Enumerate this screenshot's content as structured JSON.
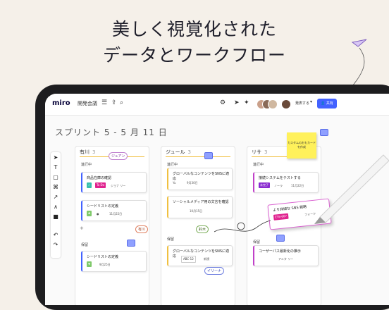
{
  "headline": {
    "line1": "美しく視覚化された",
    "line2": "データとワークフロー"
  },
  "topbar": {
    "logo": "miro",
    "board_name": "開発会議",
    "present_label": "発表する",
    "share_label": "共有"
  },
  "board": {
    "title": "スプリント 5 - 5 月 11 日"
  },
  "columns": [
    {
      "name": "有川",
      "count": "3",
      "sections": [
        {
          "label": "進行中"
        },
        {
          "label": "保留"
        }
      ],
      "cards": [
        {
          "title": "商品在庫の確認",
          "tag": "To Do",
          "assignee": "ジョナ リー"
        },
        {
          "title": "シードリストの定義",
          "date": "11月22日"
        },
        {
          "title": "シードリストの定義",
          "date": "9月25日"
        }
      ]
    },
    {
      "name": "ジュール",
      "count": "3",
      "sections": [
        {
          "label": "進行中"
        },
        {
          "label": "保留"
        }
      ],
      "cards": [
        {
          "title": "グローバルなコンテンツをSNSに適応",
          "date": "9月30日",
          "assignee": "Yu"
        },
        {
          "title": "ソーシャルメディア用の文言を確認",
          "date": "10月15日"
        },
        {
          "title": "グローバルなコンテンツをSNSに適応",
          "tag": "ABC-12",
          "status": "新規"
        }
      ]
    },
    {
      "name": "リサ",
      "count": "3",
      "sections": [
        {
          "label": "進行中"
        },
        {
          "label": "保留"
        }
      ],
      "cards": [
        {
          "title": "接続システムをテストする",
          "tag": "未完了",
          "date": "11月22日",
          "assignee": "ノーラ"
        },
        {
          "title": "コーザーパス最新化の推示",
          "assignee": "アニタ リー"
        }
      ]
    }
  ],
  "dragged_card": {
    "title": "より詳細な SNS 戦略",
    "tag": "ETB-667",
    "assignee": "フォーク"
  },
  "sticky": {
    "text": "カスタムのおもカードを作成"
  },
  "cursors": [
    {
      "name": "ジュアン"
    },
    {
      "name": "有川"
    },
    {
      "name": "鈴木"
    },
    {
      "name": "イリーナ"
    }
  ],
  "colors": {
    "accent": "#4262ff",
    "sticky": "#fff15b",
    "brand": "#050038"
  }
}
